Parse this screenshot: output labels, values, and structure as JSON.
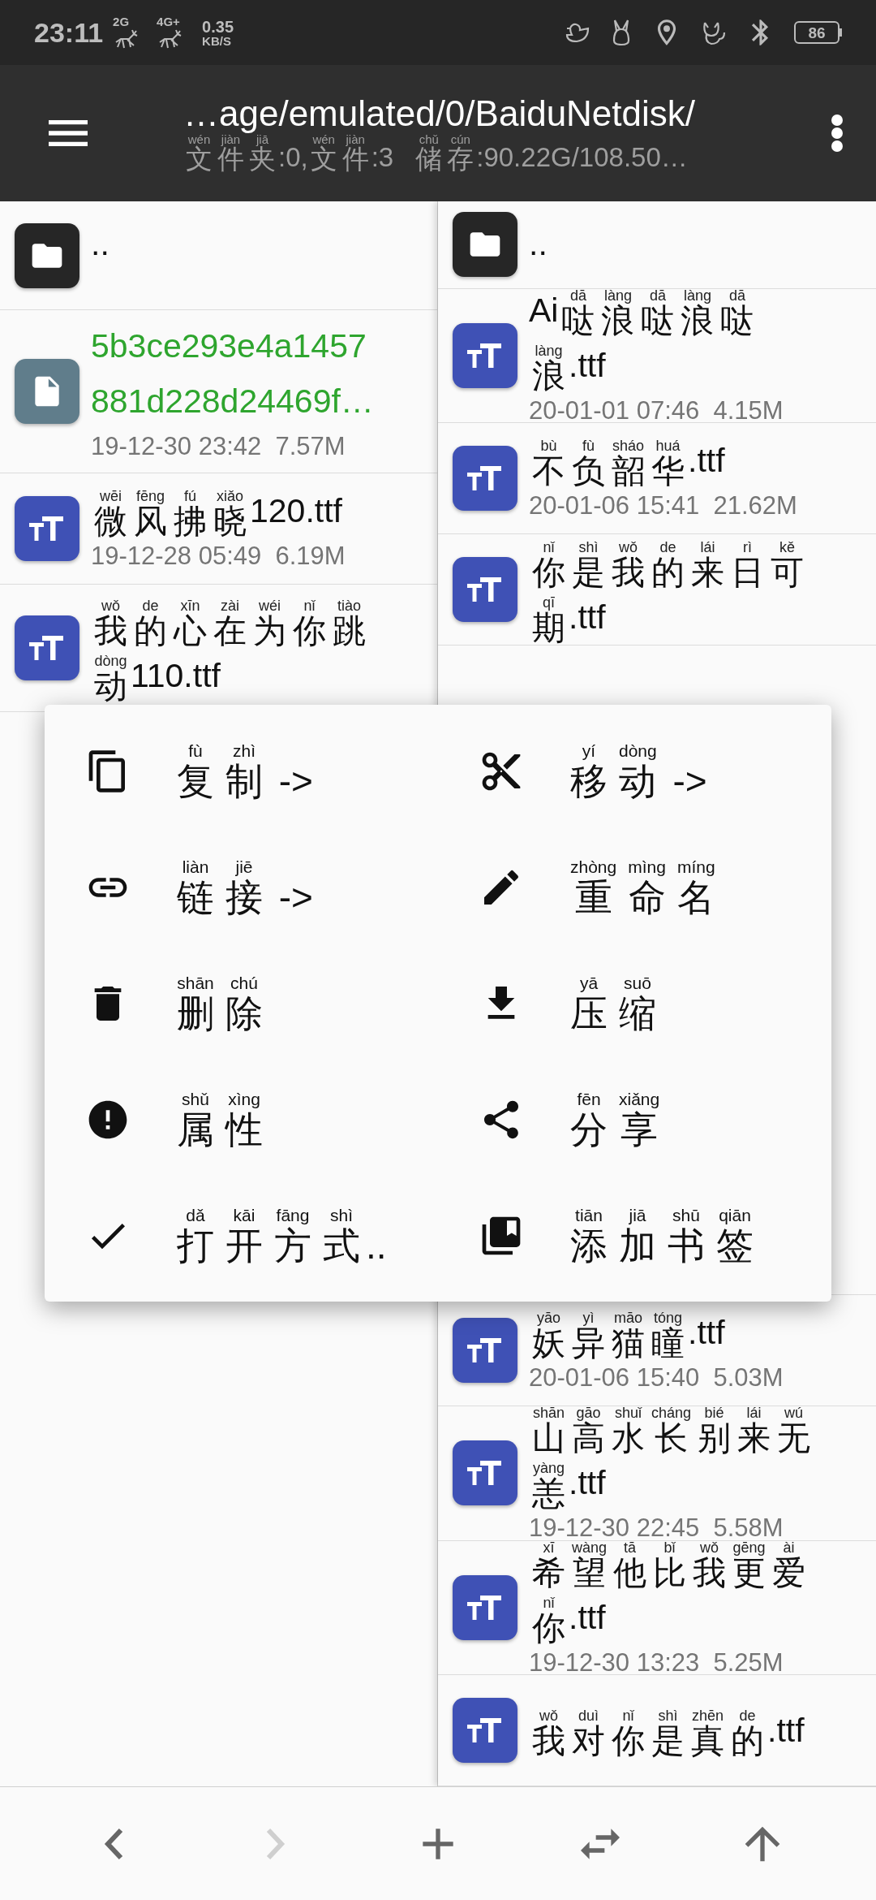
{
  "status_bar": {
    "time": "23:11",
    "sim1": "2G",
    "sim2": "4G+",
    "speed": "0.35",
    "speed_unit": "KB/S",
    "battery": "86"
  },
  "app_bar": {
    "path": "…age/emulated/0/BaiduNetdisk/",
    "folder_stats": [
      [
        "wén",
        "文"
      ],
      [
        "jiàn",
        "件"
      ],
      [
        "jiā",
        "夹"
      ],
      [
        ":0,"
      ],
      [
        "wén",
        "文"
      ],
      [
        "jiàn",
        "件"
      ],
      [
        ":3"
      ]
    ],
    "storage": [
      [
        "chǔ",
        "储"
      ],
      [
        "cún",
        "存"
      ],
      [
        ":90.22G/108.50…"
      ]
    ]
  },
  "left_pane": [
    {
      "kind": "folder",
      "selected": false,
      "name": [
        [
          ".."
        ]
      ]
    },
    {
      "kind": "file",
      "selected": true,
      "name": [
        [
          "5b3ce293e4a1457881d228d24469f…"
        ]
      ],
      "info": "19-12-30 23:42  7.57M"
    },
    {
      "kind": "font",
      "selected": false,
      "name": [
        [
          "wēi",
          "微"
        ],
        [
          "fēng",
          "风"
        ],
        [
          "fú",
          "拂"
        ],
        [
          "xiǎo",
          "晓"
        ],
        [
          "120.ttf"
        ]
      ],
      "info": "19-12-28 05:49  6.19M"
    },
    {
      "kind": "font",
      "selected": false,
      "name": [
        [
          "wǒ",
          "我"
        ],
        [
          "de",
          "的"
        ],
        [
          "xīn",
          "心"
        ],
        [
          "zài",
          "在"
        ],
        [
          "wéi",
          "为"
        ],
        [
          "nǐ",
          "你"
        ],
        [
          "tiào",
          "跳"
        ],
        [
          "dòng",
          "动"
        ],
        [
          "110.ttf"
        ]
      ]
    }
  ],
  "right_pane_top": [
    {
      "kind": "folder",
      "selected": false,
      "name": [
        [
          ".."
        ]
      ]
    },
    {
      "kind": "font",
      "selected": false,
      "name": [
        [
          "Ai"
        ],
        [
          "dā",
          "哒"
        ],
        [
          "làng",
          "浪"
        ],
        [
          "dā",
          "哒"
        ],
        [
          "làng",
          "浪"
        ],
        [
          "dā",
          "哒"
        ],
        [
          "làng",
          "浪"
        ],
        [
          ".ttf"
        ]
      ],
      "info": "20-01-01 07:46  4.15M"
    },
    {
      "kind": "font",
      "selected": false,
      "name": [
        [
          "bù",
          "不"
        ],
        [
          "fù",
          "负"
        ],
        [
          "sháo",
          "韶"
        ],
        [
          "huá",
          "华"
        ],
        [
          ".ttf"
        ]
      ],
      "info": "20-01-06 15:41  21.62M"
    },
    {
      "kind": "font",
      "selected": false,
      "name": [
        [
          "nǐ",
          "你"
        ],
        [
          "shì",
          "是"
        ],
        [
          "wǒ",
          "我"
        ],
        [
          "de",
          "的"
        ],
        [
          "lái",
          "来"
        ],
        [
          "rì",
          "日"
        ],
        [
          "kě",
          "可"
        ],
        [
          "qī",
          "期"
        ],
        [
          ".ttf"
        ]
      ]
    }
  ],
  "right_pane_bottom": [
    {
      "kind": "font",
      "selected": false,
      "name": [
        [
          "yāo",
          "妖"
        ],
        [
          "yì",
          "异"
        ],
        [
          "māo",
          "猫"
        ],
        [
          "tóng",
          "瞳"
        ],
        [
          ".ttf"
        ]
      ],
      "info": "20-01-06 15:40  5.03M"
    },
    {
      "kind": "font",
      "selected": false,
      "name": [
        [
          "shān",
          "山"
        ],
        [
          "gāo",
          "高"
        ],
        [
          "shuǐ",
          "水"
        ],
        [
          "cháng",
          "长"
        ],
        [
          "bié",
          "别"
        ],
        [
          "lái",
          "来"
        ],
        [
          "wú",
          "无"
        ],
        [
          "yàng",
          "恙"
        ],
        [
          ".ttf"
        ]
      ],
      "info": "19-12-30 22:45  5.58M"
    },
    {
      "kind": "font",
      "selected": false,
      "name": [
        [
          "xī",
          "希"
        ],
        [
          "wàng",
          "望"
        ],
        [
          "tā",
          "他"
        ],
        [
          "bǐ",
          "比"
        ],
        [
          "wǒ",
          "我"
        ],
        [
          "gēng",
          "更"
        ],
        [
          "ài",
          "爱"
        ],
        [
          "nǐ",
          "你"
        ],
        [
          ".ttf"
        ]
      ],
      "info": "19-12-30 13:23  5.25M"
    },
    {
      "kind": "font",
      "selected": false,
      "name": [
        [
          "wǒ",
          "我"
        ],
        [
          "duì",
          "对"
        ],
        [
          "nǐ",
          "你"
        ],
        [
          "shì",
          "是"
        ],
        [
          "zhēn",
          "真"
        ],
        [
          "de",
          "的"
        ],
        [
          ".ttf"
        ]
      ]
    }
  ],
  "context_menu": [
    {
      "kind": "copy",
      "label": [
        [
          "fù",
          "复"
        ],
        [
          "zhì",
          "制"
        ],
        [
          " ->"
        ]
      ]
    },
    {
      "kind": "move",
      "label": [
        [
          "yí",
          "移"
        ],
        [
          "dòng",
          "动"
        ],
        [
          " ->"
        ]
      ]
    },
    {
      "kind": "link",
      "label": [
        [
          "liàn",
          "链"
        ],
        [
          "jiē",
          "接"
        ],
        [
          " ->"
        ]
      ]
    },
    {
      "kind": "rename",
      "label": [
        [
          "zhòng",
          "重"
        ],
        [
          "mìng",
          "命"
        ],
        [
          "míng",
          "名"
        ]
      ]
    },
    {
      "kind": "delete",
      "label": [
        [
          "shān",
          "删"
        ],
        [
          "chú",
          "除"
        ]
      ]
    },
    {
      "kind": "compress",
      "label": [
        [
          "yā",
          "压"
        ],
        [
          "suō",
          "缩"
        ]
      ]
    },
    {
      "kind": "properties",
      "label": [
        [
          "shǔ",
          "属"
        ],
        [
          "xìng",
          "性"
        ]
      ]
    },
    {
      "kind": "share",
      "label": [
        [
          "fēn",
          "分"
        ],
        [
          "xiǎng",
          "享"
        ]
      ]
    },
    {
      "kind": "open_with",
      "label": [
        [
          "dǎ",
          "打"
        ],
        [
          "kāi",
          "开"
        ],
        [
          "fāng",
          "方"
        ],
        [
          "shì",
          "式"
        ],
        [
          ".."
        ]
      ]
    },
    {
      "kind": "bookmark",
      "label": [
        [
          "tiān",
          "添"
        ],
        [
          "jiā",
          "加"
        ],
        [
          "shū",
          "书"
        ],
        [
          "qiān",
          "签"
        ]
      ]
    }
  ],
  "bottom_bar": [
    {
      "kind": "back",
      "disabled": false
    },
    {
      "kind": "forward",
      "disabled": true
    },
    {
      "kind": "add",
      "disabled": false
    },
    {
      "kind": "swap",
      "disabled": false
    },
    {
      "kind": "up",
      "disabled": false
    }
  ]
}
